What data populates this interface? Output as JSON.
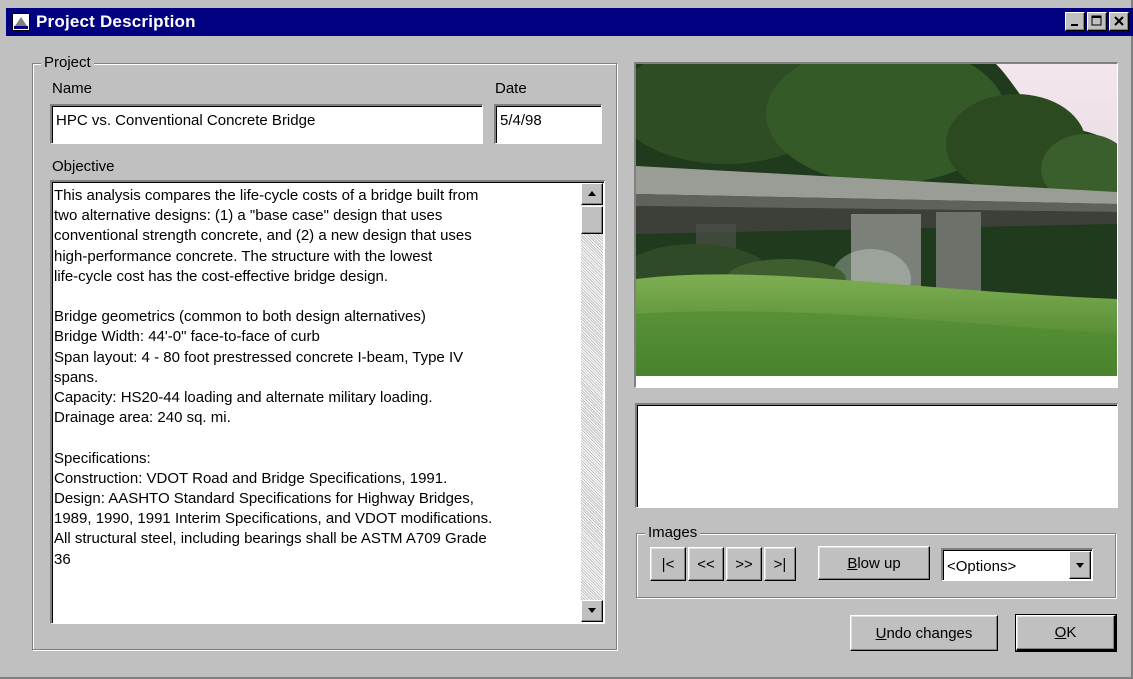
{
  "window": {
    "title": "Project Description",
    "controls": [
      "minimize-icon",
      "maximize-icon",
      "close-icon"
    ]
  },
  "project": {
    "group_label": "Project",
    "name_label": "Name",
    "name_value": "HPC vs. Conventional Concrete Bridge",
    "date_label": "Date",
    "date_value": "5/4/98",
    "objective_label": "Objective",
    "objective_text": "This analysis compares the life-cycle costs of a bridge built from\ntwo alternative designs: (1) a \"base case\" design that uses\nconventional strength concrete, and (2) a new design that uses\nhigh-performance concrete. The structure with the lowest\nlife-cycle cost has the cost-effective bridge design.\n\nBridge geometrics (common to both design alternatives)\nBridge Width: 44'-0\" face-to-face of curb\nSpan layout: 4 - 80 foot prestressed concrete I-beam, Type IV\nspans.\nCapacity: HS20-44 loading and alternate military loading.\nDrainage area: 240 sq. mi.\n\nSpecifications:\nConstruction: VDOT Road and Bridge Specifications, 1991.\nDesign: AASHTO Standard Specifications for Highway Bridges,\n1989, 1990, 1991 Interim Specifications, and VDOT modifications.\nAll structural steel, including bearings shall be ASTM A709 Grade\n36"
  },
  "images": {
    "photo": "bridge-photo",
    "caption_text": "",
    "group_label": "Images",
    "first_label": "|<",
    "prev_label": "<<",
    "next_label": ">>",
    "last_label": ">|",
    "blowup_label": "Blow up",
    "blowup_access_key": "B",
    "blowup_rest": "low up",
    "options_value": "<Options>"
  },
  "actions": {
    "undo_label": "Undo changes",
    "undo_access_key": "U",
    "undo_rest": "ndo changes",
    "ok_label": "OK",
    "ok_access_key": "O",
    "ok_rest": "K"
  },
  "colors": {
    "titlebar": "#000080",
    "face": "#c0c0c0"
  }
}
